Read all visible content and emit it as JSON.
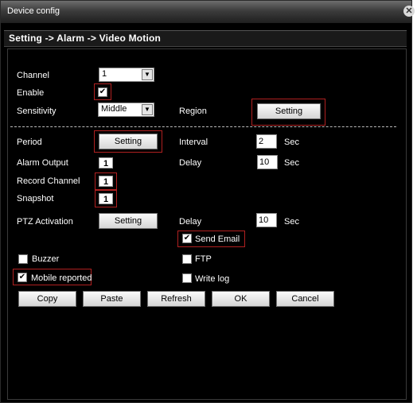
{
  "window": {
    "title": "Device config"
  },
  "breadcrumb": "Setting -> Alarm -> Video Motion",
  "labels": {
    "channel": "Channel",
    "enable": "Enable",
    "sensitivity": "Sensitivity",
    "region": "Region",
    "period": "Period",
    "interval": "Interval",
    "alarm_output": "Alarm Output",
    "delay": "Delay",
    "record_channel": "Record Channel",
    "snapshot": "Snapshot",
    "ptz_activation": "PTZ Activation",
    "ptz_delay": "Delay",
    "sec1": "Sec",
    "sec2": "Sec",
    "sec3": "Sec"
  },
  "fields": {
    "channel": "1",
    "sensitivity": "Middle",
    "interval": "2",
    "delay": "10",
    "ptz_delay": "10",
    "alarm_output": "1",
    "record_channel": "1",
    "snapshot": "1"
  },
  "buttons": {
    "region_setting": "Setting",
    "period_setting": "Setting",
    "ptz_setting": "Setting",
    "copy": "Copy",
    "paste": "Paste",
    "refresh": "Refresh",
    "ok": "OK",
    "cancel": "Cancel"
  },
  "checkboxes": {
    "enable": {
      "checked": true
    },
    "send_email": {
      "label": "Send Email",
      "checked": true
    },
    "buzzer": {
      "label": "Buzzer",
      "checked": false
    },
    "ftp": {
      "label": "FTP",
      "checked": false
    },
    "mobile_reported": {
      "label": "Mobile reported",
      "checked": true
    },
    "write_log": {
      "label": "Write log",
      "checked": false
    }
  },
  "colors": {
    "background": "#000000",
    "highlight": "#b02020",
    "text": "#ffffff"
  }
}
